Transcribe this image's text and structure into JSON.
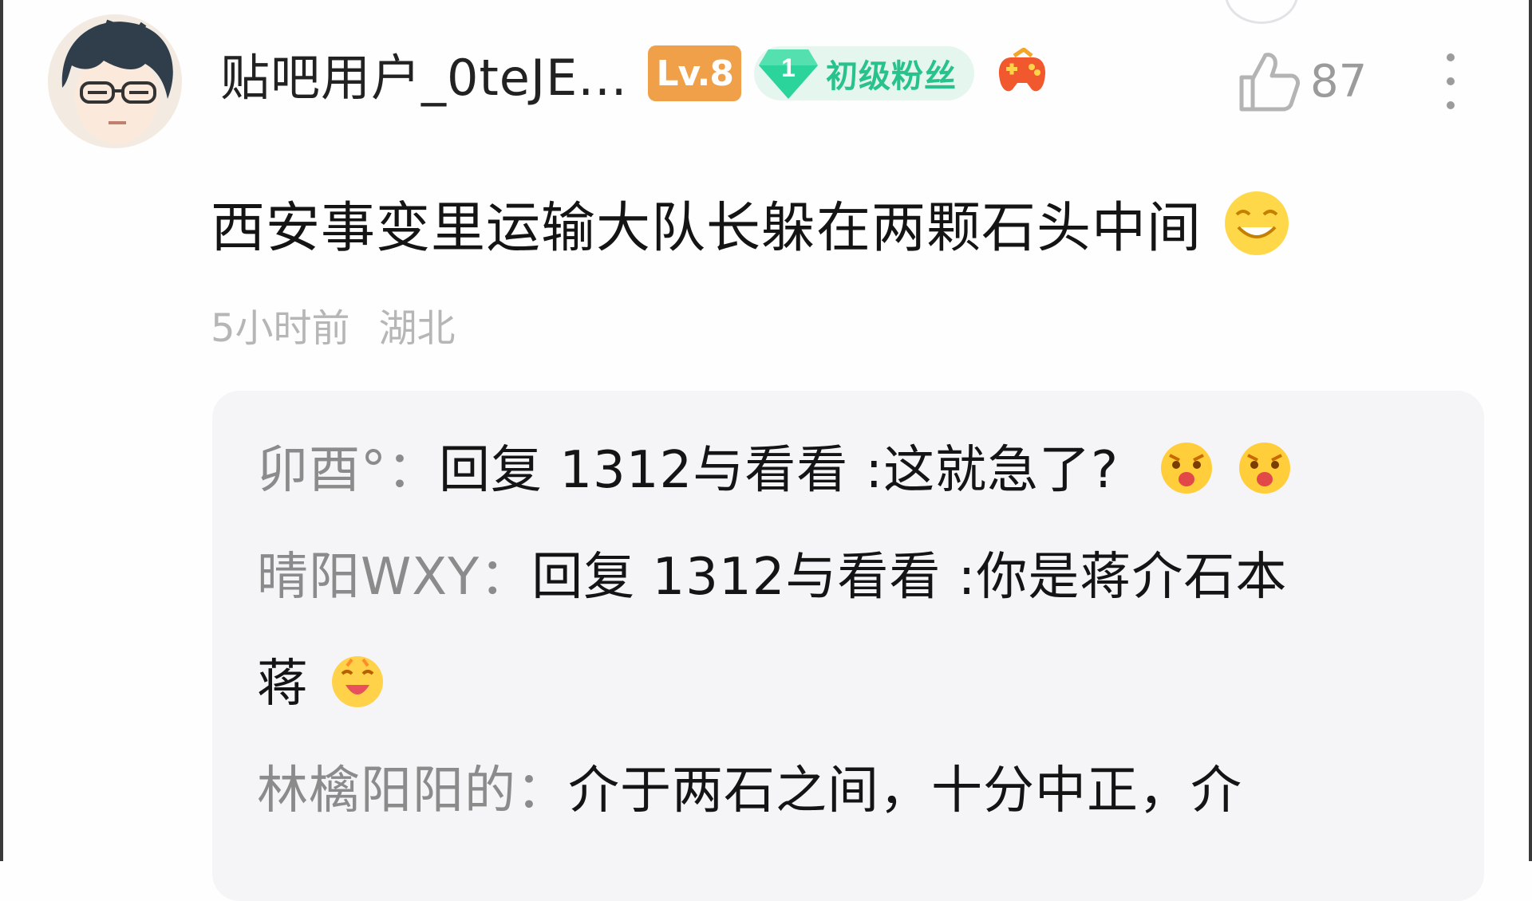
{
  "colors": {
    "level_badge_bg": "#f0a048",
    "fan_badge_bg": "#e4f6ee",
    "fan_badge_text": "#28c28c",
    "gem": "#2ad49a"
  },
  "comment": {
    "author": {
      "name": "贴吧用户_0teJE...",
      "level": "Lv.8",
      "fan_badge": {
        "number": "1",
        "label": "初级粉丝"
      }
    },
    "likes": "87",
    "text": "西安事变里运输大队长躲在两颗石头中间",
    "time": "5小时前",
    "location": "湖北",
    "icons": [
      "avatar",
      "fan-gem-icon",
      "game-controller-icon",
      "thumbs-up-icon",
      "more-vertical-icon",
      "smile-emoji-icon"
    ]
  },
  "replies": [
    {
      "author": "卯酉°：",
      "body": "回复 1312与看看 :这就急了?",
      "emojis": [
        "shocked-emoji",
        "shocked-emoji"
      ]
    },
    {
      "author": "晴阳WXY：",
      "body_line1": "回复 1312与看看 :你是蒋介石本",
      "body_line2": "蒋",
      "emojis": [
        "laughing-emoji"
      ]
    },
    {
      "author": "林檎阳阳的：",
      "body": "介于两石之间，十分中正，介"
    }
  ]
}
